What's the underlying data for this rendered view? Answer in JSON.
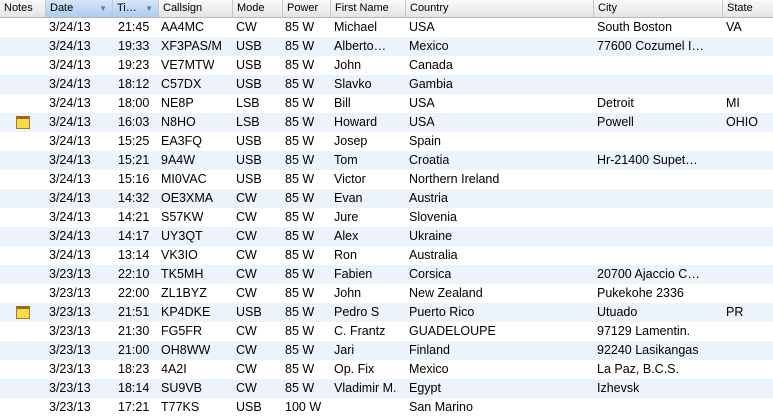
{
  "columns": [
    "Notes",
    "Date",
    "Ti…",
    "Callsign",
    "Mode",
    "Power",
    "First Name",
    "Country",
    "City",
    "State"
  ],
  "rows": [
    {
      "note": false,
      "date": "3/24/13",
      "time": "21:45",
      "call": "AA4MC",
      "mode": "CW",
      "power": "85 W",
      "name": "Michael",
      "country": "USA",
      "city": "South Boston",
      "state": "VA"
    },
    {
      "note": false,
      "date": "3/24/13",
      "time": "19:33",
      "call": "XF3PAS/M",
      "mode": "USB",
      "power": "85 W",
      "name": "Alberto…",
      "country": "Mexico",
      "city": "77600 Cozumel I…",
      "state": ""
    },
    {
      "note": false,
      "date": "3/24/13",
      "time": "19:23",
      "call": "VE7MTW",
      "mode": "USB",
      "power": "85 W",
      "name": "John",
      "country": "Canada",
      "city": "",
      "state": ""
    },
    {
      "note": false,
      "date": "3/24/13",
      "time": "18:12",
      "call": "C57DX",
      "mode": "USB",
      "power": "85 W",
      "name": "Slavko",
      "country": "Gambia",
      "city": "",
      "state": ""
    },
    {
      "note": false,
      "date": "3/24/13",
      "time": "18:00",
      "call": "NE8P",
      "mode": "LSB",
      "power": "85 W",
      "name": "Bill",
      "country": "USA",
      "city": "Detroit",
      "state": "MI"
    },
    {
      "note": true,
      "date": "3/24/13",
      "time": "16:03",
      "call": "N8HO",
      "mode": "LSB",
      "power": "85 W",
      "name": "Howard",
      "country": "USA",
      "city": "Powell",
      "state": "OHIO"
    },
    {
      "note": false,
      "date": "3/24/13",
      "time": "15:25",
      "call": "EA3FQ",
      "mode": "USB",
      "power": "85 W",
      "name": "Josep",
      "country": "Spain",
      "city": "",
      "state": ""
    },
    {
      "note": false,
      "date": "3/24/13",
      "time": "15:21",
      "call": "9A4W",
      "mode": "USB",
      "power": "85 W",
      "name": "Tom",
      "country": "Croatia",
      "city": "Hr-21400 Supet…",
      "state": ""
    },
    {
      "note": false,
      "date": "3/24/13",
      "time": "15:16",
      "call": "MI0VAC",
      "mode": "USB",
      "power": "85 W",
      "name": "Victor",
      "country": "Northern Ireland",
      "city": "",
      "state": ""
    },
    {
      "note": false,
      "date": "3/24/13",
      "time": "14:32",
      "call": "OE3XMA",
      "mode": "CW",
      "power": "85 W",
      "name": "Evan",
      "country": "Austria",
      "city": "",
      "state": ""
    },
    {
      "note": false,
      "date": "3/24/13",
      "time": "14:21",
      "call": "S57KW",
      "mode": "CW",
      "power": "85 W",
      "name": "Jure",
      "country": "Slovenia",
      "city": "",
      "state": ""
    },
    {
      "note": false,
      "date": "3/24/13",
      "time": "14:17",
      "call": "UY3QT",
      "mode": "CW",
      "power": "85 W",
      "name": "Alex",
      "country": "Ukraine",
      "city": "",
      "state": ""
    },
    {
      "note": false,
      "date": "3/24/13",
      "time": "13:14",
      "call": "VK3IO",
      "mode": "CW",
      "power": "85 W",
      "name": "Ron",
      "country": "Australia",
      "city": "",
      "state": ""
    },
    {
      "note": false,
      "date": "3/23/13",
      "time": "22:10",
      "call": "TK5MH",
      "mode": "CW",
      "power": "85 W",
      "name": "Fabien",
      "country": "Corsica",
      "city": "20700 Ajaccio C…",
      "state": ""
    },
    {
      "note": false,
      "date": "3/23/13",
      "time": "22:00",
      "call": "ZL1BYZ",
      "mode": "CW",
      "power": "85 W",
      "name": "John",
      "country": "New Zealand",
      "city": "Pukekohe 2336",
      "state": ""
    },
    {
      "note": true,
      "date": "3/23/13",
      "time": "21:51",
      "call": "KP4DKE",
      "mode": "USB",
      "power": "85 W",
      "name": "Pedro S",
      "country": "Puerto Rico",
      "city": "Utuado",
      "state": "PR"
    },
    {
      "note": false,
      "date": "3/23/13",
      "time": "21:30",
      "call": "FG5FR",
      "mode": "CW",
      "power": "85 W",
      "name": "C. Frantz",
      "country": "GUADELOUPE",
      "city": "97129 Lamentin.",
      "state": ""
    },
    {
      "note": false,
      "date": "3/23/13",
      "time": "21:00",
      "call": "OH8WW",
      "mode": "CW",
      "power": "85 W",
      "name": "Jari",
      "country": "Finland",
      "city": "92240 Lasikangas",
      "state": ""
    },
    {
      "note": false,
      "date": "3/23/13",
      "time": "18:23",
      "call": "4A2I",
      "mode": "CW",
      "power": "85 W",
      "name": "Op. Fix",
      "country": "Mexico",
      "city": "La Paz, B.C.S.",
      "state": ""
    },
    {
      "note": false,
      "date": "3/23/13",
      "time": "18:14",
      "call": "SU9VB",
      "mode": "CW",
      "power": "85 W",
      "name": "Vladimir M.",
      "country": "Egypt",
      "city": "Izhevsk",
      "state": ""
    },
    {
      "note": false,
      "date": "3/23/13",
      "time": "17:21",
      "call": "T77KS",
      "mode": "USB",
      "power": "100 W",
      "name": "",
      "country": "San Marino",
      "city": "",
      "state": ""
    }
  ]
}
